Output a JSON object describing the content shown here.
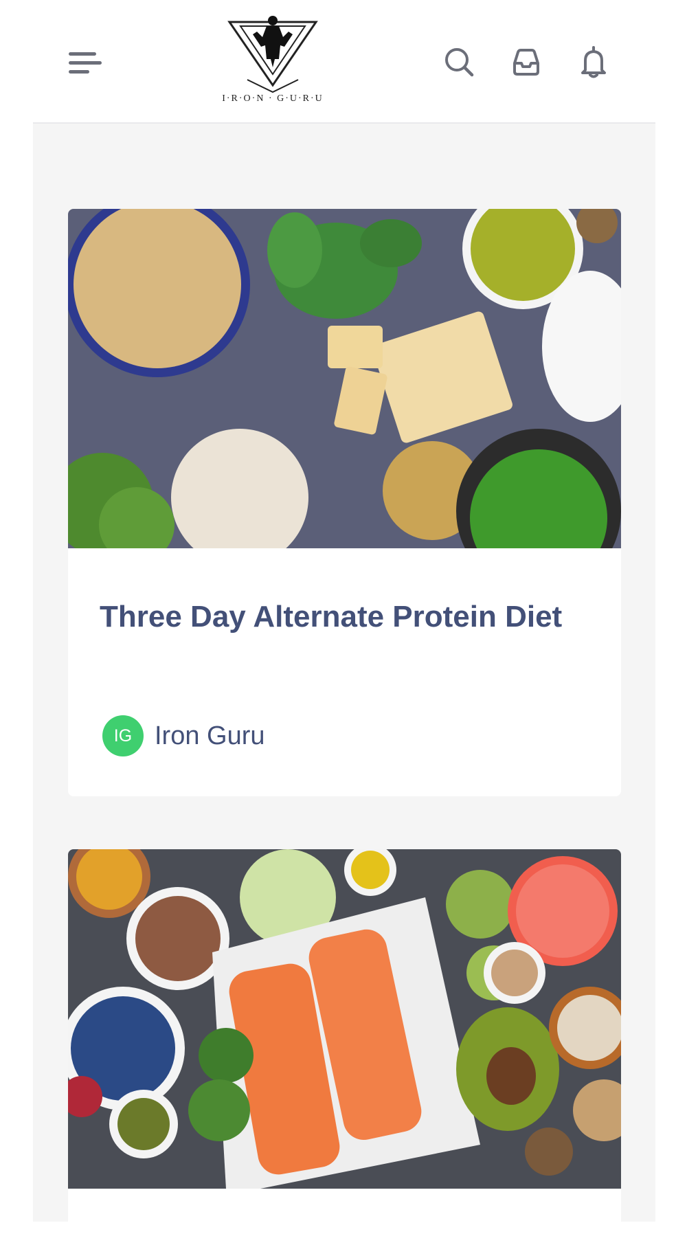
{
  "header": {
    "logo_text": "I·R·O·N · G·U·R·U",
    "icons": {
      "menu": "menu-icon",
      "search": "search-icon",
      "inbox": "inbox-icon",
      "notifications": "bell-icon"
    }
  },
  "colors": {
    "title": "#435078",
    "avatar_bg": "#3fcf6f",
    "page_bg": "#f5f5f5",
    "icon_gray": "#6b6e79"
  },
  "posts": [
    {
      "title": "Three Day Alternate Protein Diet",
      "author_initials": "IG",
      "author_name": "Iron Guru",
      "image": "photo of plant protein foods: soybeans, spinach, tempeh, peas, milk, chickpeas, mung beans, seaweed, broccoli"
    },
    {
      "image": "photo of healthy foods: salmon fillets, avocado, blueberries, brussels sprouts, grapefruit, turmeric, seeds, nuts, broccoli"
    }
  ]
}
